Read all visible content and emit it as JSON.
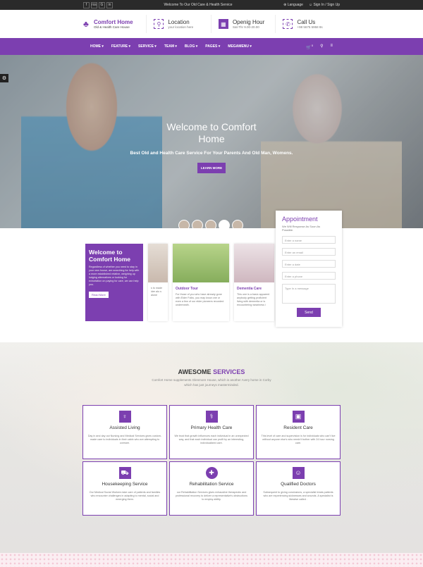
{
  "topbar": {
    "social": [
      "f",
      "rss",
      "G",
      "in"
    ],
    "welcome": "Welcome To Our Old Care & Health Service",
    "language": "Language",
    "signin": "Sign In / Sign Up"
  },
  "header": {
    "logo_title": "Comfort Home",
    "logo_sub": "Old & Health Care House",
    "info": [
      {
        "title": "Location",
        "sub": "your location here"
      },
      {
        "title": "Openig Hour",
        "sub": "Sat-Thr 9.00-20.00"
      },
      {
        "title": "Call Us",
        "sub": "+98 5675 5958 8s"
      }
    ]
  },
  "nav": {
    "items": [
      "HOME ▾",
      "FEATURE ▾",
      "SERVICE ▾",
      "TEAM ▾",
      "BLOG ▾",
      "PAGES ▾",
      "MEGAMENU ▾"
    ],
    "cart_count": "0"
  },
  "hero": {
    "title": "Welcome to Comfort Home",
    "subtitle": "Best Old and Health Care Service For Your Parents And Old Man, Womens.",
    "button": "LEARN MORE"
  },
  "appointment": {
    "title": "Appointment",
    "sub": "We Will Response As Soon As Possible.",
    "fields": [
      "Enter a name",
      "Enter an email",
      "Enter a date",
      "Enter a phone"
    ],
    "message": "Type In a message",
    "send": "Send"
  },
  "welcome": {
    "title": "Welcome to Comfort Home",
    "text": "Regardless of whether you need to stay in your own house, are searching for help with a more established relative, weighing up lodging alternatives or looking for exhortation on paying for care, we can help you.",
    "button": "Read More"
  },
  "cards": [
    {
      "title": "",
      "text": "s to made ider alo s alone"
    },
    {
      "title": "Outdoor Tour",
      "text": "For those of you who have already gone with Elder Folks, you may know one or even a few of our elder pioneers recorded underneath."
    },
    {
      "title": "Dementia Care",
      "text": "This one is a basic apparent anybody getting proficient living with dementia or is encountering weariness i"
    }
  ],
  "services": {
    "title_a": "AWESOME",
    "title_b": "SERVICES",
    "sub": "Comfort Home supplements Glenmore House, which is another Avery home in Corby which has just journeys masterminded.",
    "boxes": [
      {
        "title": "Assisted Living",
        "text": "Day in and day out Nursing and Medical Services gives custom-made care to individuals in their cabin who are attempting to oversee."
      },
      {
        "title": "Primary Health Care",
        "text": "We trust that growth influences each individual in an unexpected way, and that each individual can profit by an interesting, individualized care."
      },
      {
        "title": "Resident Care",
        "text": "This level of care and supervision is for individuals who can't live without anyone else's who needn't bother with 24 hour nursing care."
      },
      {
        "title": "Housekeeping Service",
        "text": "Our Medical Social Workers take care of patients and families who encounter challenges in adapting to mental, social and emerging them."
      },
      {
        "title": "Rehabilitation Service",
        "text": "our Rehabilitation Services gives exhaustive therapeutic and professional recovery to deliver a representative's obstructions to employ ability."
      },
      {
        "title": "Qualified Doctors",
        "text": "Subsequent to giving conclusions, a specialist treats patients who are experiencing sicknesses and wounds. A specialist is likewise called ."
      }
    ]
  }
}
